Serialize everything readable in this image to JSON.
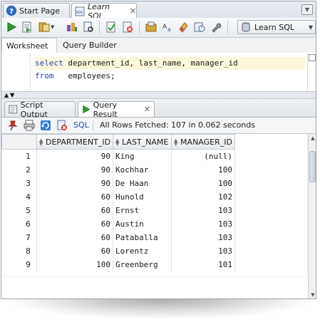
{
  "tabs": [
    {
      "label": "Start Page"
    },
    {
      "label": "Learn SQL"
    }
  ],
  "toolbar": {
    "connection_label": "Learn SQL"
  },
  "subtabs": {
    "worksheet": "Worksheet",
    "query_builder": "Query Builder"
  },
  "editor": {
    "line1_kw": "select",
    "line1_rest": " department_id, last_name, manager_id",
    "line2_kw": "from",
    "line2_rest": "   employees;"
  },
  "panel_tabs": {
    "script_output": "Script Output",
    "query_result": "Query Result"
  },
  "result_toolbar": {
    "sql_label": "SQL",
    "status": "All Rows Fetched: 107 in 0.062 seconds"
  },
  "grid": {
    "columns": [
      "DEPARTMENT_ID",
      "LAST_NAME",
      "MANAGER_ID"
    ],
    "rows": [
      {
        "n": "1",
        "dept": "90",
        "name": "King",
        "mgr": "(null)"
      },
      {
        "n": "2",
        "dept": "90",
        "name": "Kochhar",
        "mgr": "100"
      },
      {
        "n": "3",
        "dept": "90",
        "name": "De Haan",
        "mgr": "100"
      },
      {
        "n": "4",
        "dept": "60",
        "name": "Hunold",
        "mgr": "102"
      },
      {
        "n": "5",
        "dept": "60",
        "name": "Ernst",
        "mgr": "103"
      },
      {
        "n": "6",
        "dept": "60",
        "name": "Austin",
        "mgr": "103"
      },
      {
        "n": "7",
        "dept": "60",
        "name": "Pataballa",
        "mgr": "103"
      },
      {
        "n": "8",
        "dept": "60",
        "name": "Lorentz",
        "mgr": "103"
      },
      {
        "n": "9",
        "dept": "100",
        "name": "Greenberg",
        "mgr": "101"
      }
    ]
  },
  "colors": {
    "keyword": "#1e3fbf",
    "sql_link": "#1e4fb8",
    "run_green": "#2e9b2e"
  }
}
